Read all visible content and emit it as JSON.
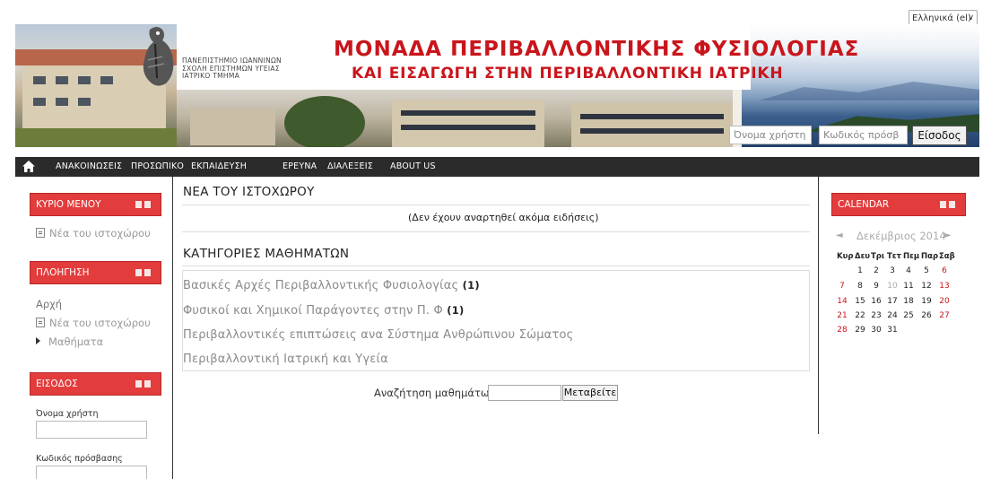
{
  "language": {
    "selected": "Ελληνικά (el)"
  },
  "header": {
    "university_lines": [
      "ΠΑΝΕΠΙΣΤΗΜΙΟ ΙΩΑΝΝΙΝΩΝ",
      "ΣΧΟΛΗ ΕΠΙΣΤΗΜΩΝ ΥΓΕΙΑΣ",
      "ΙΑΤΡΙΚΟ ΤΜΗΜΑ"
    ],
    "title_line1": "ΜΟΝΑΔΑ ΠΕΡΙΒΑΛΛΟΝΤΙΚΗΣ ΦΥΣΙΟΛΟΓΙΑΣ",
    "title_line2": "ΚΑΙ ΕΙΣΑΓΩΓΗ ΣΤΗΝ ΠΕΡΙΒΑΛΛΟΝΤΙΚΗ ΙΑΤΡΙΚΗ",
    "username_placeholder": "Όνομα χρήστη",
    "password_placeholder": "Κωδικός πρόσβ",
    "login_button": "Είσοδος"
  },
  "nav": {
    "home_icon": "home-icon",
    "items": [
      "ΑΝΑΚΟΙΝΩΣΕΙΣ",
      "ΠΡΟΣΩΠΙΚΟ",
      "ΕΚΠΑΙΔΕΥΣΗ",
      "ΕΡΕΥΝΑ",
      "ΔΙΑΛΕΞΕΙΣ",
      "ABOUT US"
    ]
  },
  "left": {
    "main_menu": {
      "title": "ΚΥΡΙΟ ΜΕΝΟΥ",
      "items": [
        "Νέα του ιστοχώρου"
      ]
    },
    "navigation": {
      "title": "ΠΛΟΗΓΗΣΗ",
      "home": "Αρχή",
      "site_news": "Νέα του ιστοχώρου",
      "courses": "Μαθήματα"
    },
    "login": {
      "title": "ΕΙΣΟΔΟΣ",
      "username_label": "Όνομα χρήστη",
      "password_label": "Κωδικός πρόσβασης"
    }
  },
  "main": {
    "news_title": "ΝΕΑ ΤΟΥ ΙΣΤΟΧΩΡΟΥ",
    "no_news": "(Δεν έχουν αναρτηθεί ακόμα ειδήσεις)",
    "categories_title": "ΚΑΤΗΓΟΡΙΕΣ ΜΑΘΗΜΑΤΩΝ",
    "categories": [
      {
        "name": "Βασικές Αρχές Περιβαλλοντικής Φυσιολογίας",
        "count": "(1)"
      },
      {
        "name": "Φυσικοί και Χημικοί Παράγοντες στην Π. Φ",
        "count": "(1)"
      },
      {
        "name": "Περιβαλλοντικές επιπτώσεις ανα Σύστημα Ανθρώπινου Σώματος",
        "count": ""
      },
      {
        "name": "Περιβαλλοντική Ιατρική και Υγεία",
        "count": ""
      }
    ],
    "search_label": "Αναζήτηση μαθημάτων:",
    "search_button": "Μεταβείτε"
  },
  "calendar": {
    "title": "CALENDAR",
    "prev": "◄",
    "month": "Δεκέμβριος 2014",
    "next": "►",
    "weekdays": [
      "Κυρ",
      "Δευ",
      "Τρι",
      "Τετ",
      "Πεμ",
      "Παρ",
      "Σαβ"
    ],
    "rows": [
      [
        "",
        "1",
        "2",
        "3",
        "4",
        "5",
        "6"
      ],
      [
        "7",
        "8",
        "9",
        "10",
        "11",
        "12",
        "13"
      ],
      [
        "14",
        "15",
        "16",
        "17",
        "18",
        "19",
        "20"
      ],
      [
        "21",
        "22",
        "23",
        "24",
        "25",
        "26",
        "27"
      ],
      [
        "28",
        "29",
        "30",
        "31",
        "",
        "",
        ""
      ]
    ],
    "today": "10"
  }
}
